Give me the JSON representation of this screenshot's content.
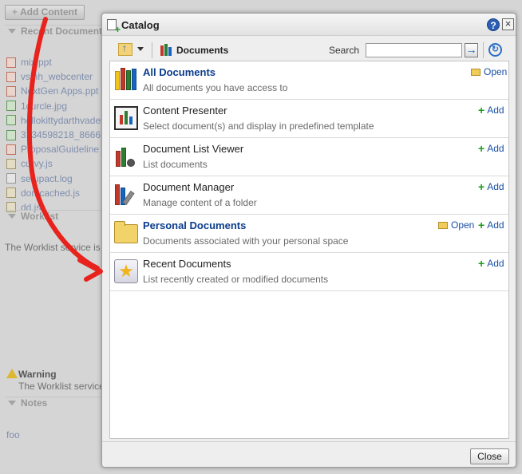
{
  "background": {
    "add_content_label": "Add Content",
    "recent_documents_title": "Recent Documents",
    "files": [
      {
        "name": "mix.ppt",
        "type": "ppt"
      },
      {
        "name": "vsinh_webcenter",
        "type": "ppt"
      },
      {
        "name": "NextGen Apps.ppt",
        "type": "ppt"
      },
      {
        "name": "1curcle.jpg",
        "type": "jpg"
      },
      {
        "name": "hellokittydarthvader",
        "type": "jpg"
      },
      {
        "name": "3134598218_8666",
        "type": "jpg"
      },
      {
        "name": "ProposalGuideline",
        "type": "ppt"
      },
      {
        "name": "curvy.js",
        "type": "js"
      },
      {
        "name": "setupact.log",
        "type": "txt"
      },
      {
        "name": "domcached.js",
        "type": "js"
      },
      {
        "name": "dd.js",
        "type": "js"
      }
    ],
    "worklist_title": "Worklist",
    "worklist_text": "The Worklist service is",
    "warning_title": "Warning",
    "warning_text": "The Worklist service",
    "notes_title": "Notes",
    "foo_link": "foo"
  },
  "dialog": {
    "title": "Catalog",
    "help_label": "?",
    "close_x": "×",
    "toolbar": {
      "location": "Documents",
      "search_label": "Search",
      "search_value": "",
      "go_label": "→"
    },
    "items": [
      {
        "name": "All Documents",
        "description": "All documents you have access to",
        "open_label": "Open",
        "add_label": ""
      },
      {
        "name": "Content Presenter",
        "description": "Select document(s) and display in predefined template",
        "open_label": "",
        "add_label": "Add"
      },
      {
        "name": "Document List Viewer",
        "description": "List documents",
        "open_label": "",
        "add_label": "Add"
      },
      {
        "name": "Document Manager",
        "description": "Manage content of a folder",
        "open_label": "",
        "add_label": "Add"
      },
      {
        "name": "Personal Documents",
        "description": "Documents associated with your personal space",
        "open_label": "Open",
        "add_label": "Add"
      },
      {
        "name": "Recent Documents",
        "description": "List recently created or modified documents",
        "open_label": "",
        "add_label": "Add"
      }
    ],
    "close_button": "Close"
  },
  "colors": {
    "link": "#1a4fa8",
    "annotation_arrow": "#e8231e",
    "add_plus": "#1a9c1a"
  }
}
